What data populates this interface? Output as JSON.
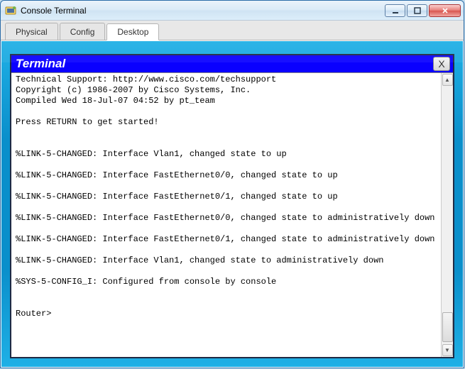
{
  "window": {
    "title": "Console Terminal"
  },
  "tabs": [
    {
      "label": "Physical",
      "active": false
    },
    {
      "label": "Config",
      "active": false
    },
    {
      "label": "Desktop",
      "active": true
    }
  ],
  "terminal": {
    "title": "Terminal",
    "close_label": "X",
    "lines": [
      "Technical Support: http://www.cisco.com/techsupport",
      "Copyright (c) 1986-2007 by Cisco Systems, Inc.",
      "Compiled Wed 18-Jul-07 04:52 by pt_team",
      "",
      "Press RETURN to get started!",
      "",
      "",
      "%LINK-5-CHANGED: Interface Vlan1, changed state to up",
      "",
      "%LINK-5-CHANGED: Interface FastEthernet0/0, changed state to up",
      "",
      "%LINK-5-CHANGED: Interface FastEthernet0/1, changed state to up",
      "",
      "%LINK-5-CHANGED: Interface FastEthernet0/0, changed state to administratively down",
      "",
      "%LINK-5-CHANGED: Interface FastEthernet0/1, changed state to administratively down",
      "",
      "%LINK-5-CHANGED: Interface Vlan1, changed state to administratively down",
      "",
      "%SYS-5-CONFIG_I: Configured from console by console",
      "",
      "",
      "Router>"
    ]
  }
}
